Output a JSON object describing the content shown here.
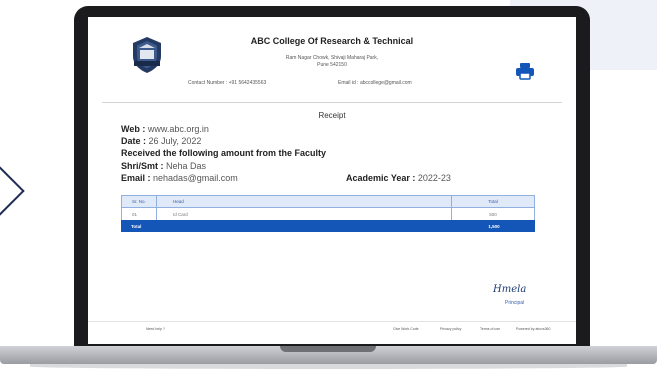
{
  "header": {
    "college_name": "ABC College Of Research & Technical",
    "address_line1": "Ram Nagar Chowk, Shivaji Maharaj Park,",
    "address_line2": "Pune 542150",
    "contact": "Contact Number : +91 5642435563",
    "email": "Email id : abccollege@gmail.com"
  },
  "receipt": {
    "title": "Receipt",
    "web_label": "Web :",
    "web_value": "www.abc.org.in",
    "date_label": "Date :",
    "date_value": "26 July, 2022",
    "received_text": "Received the following amount from the Faculty",
    "name_label": "Shri/Smt :",
    "name_value": "Neha Das",
    "email_label": "Email :",
    "email_value": "nehadas@gmail.com",
    "year_label": "Academic Year :",
    "year_value": "2022-23"
  },
  "table": {
    "headers": [
      "Sr. No.",
      "Head",
      "Total"
    ],
    "rows": [
      [
        "01",
        "Id Card",
        "500"
      ]
    ],
    "total_label": "Total",
    "total_value": "1,500"
  },
  "signature": {
    "text": "Hmela",
    "role": "Principal"
  },
  "footer": {
    "left": "Need help ?",
    "items": [
      "Give Work Code",
      "Privacy policy",
      "Terms of use",
      "Powered by abcvs360"
    ]
  },
  "colors": {
    "accent": "#1456b8",
    "header_fill": "#dfe9f7",
    "laptop_bezel": "#1b1b1d"
  },
  "icons": [
    "college-crest-icon",
    "print-icon"
  ]
}
